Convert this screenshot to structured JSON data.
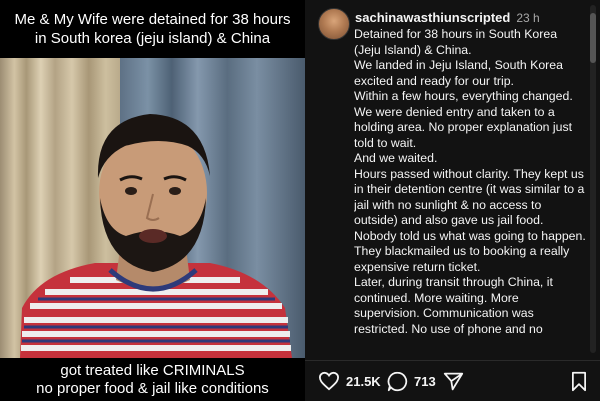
{
  "video": {
    "top_caption": "Me & My Wife were detained for 38 hours\nin South korea (jeju island) & China",
    "bottom_caption": "got treated like CRIMINALS\nno proper food & jail like conditions"
  },
  "post": {
    "username": "sachinawasthiunscripted",
    "time": "23 h",
    "caption": "Detained for 38 hours in South Korea (Jeju Island) & China.\nWe landed in Jeju Island, South Korea excited and ready for our trip.\nWithin a few hours, everything changed.\nWe were denied entry and taken to a holding area. No proper explanation just told to wait.\nAnd we waited.\nHours passed without clarity. They kept us in their detention centre (it was similar to a jail with no sunlight & no access to outside) and also gave us jail food.\nNobody told us what was going to happen. They blackmailed us to booking a really expensive return ticket.\nLater, during transit through China, it continued. More waiting. More supervision. Communication was restricted. No use of phone and no"
  },
  "actions": {
    "likes": "21.5K",
    "comments": "713",
    "icons": [
      "heart-icon",
      "comment-icon",
      "share-icon",
      "bookmark-icon"
    ]
  },
  "colors": {
    "panel_bg": "#121212",
    "text": "#f5f5f5",
    "muted": "#a8a8a8"
  }
}
